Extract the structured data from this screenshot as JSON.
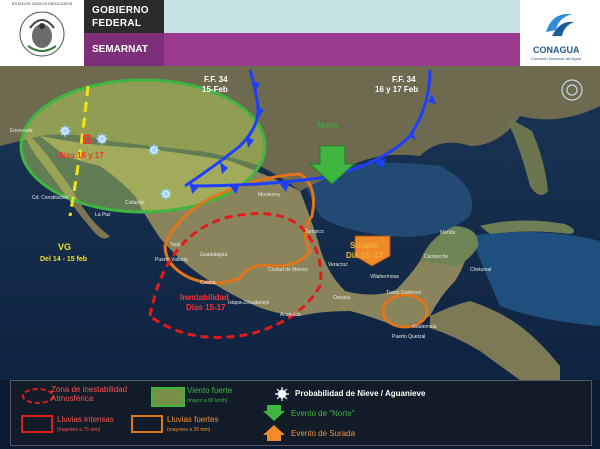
{
  "header": {
    "gov_line1": "GOBIERNO",
    "gov_line2": "FEDERAL",
    "agency": "SEMARNAT",
    "seal_caption": "ESTADOS UNIDOS MEXICANOS",
    "brand": "CONAGUA",
    "brand_sub": "Comisión Nacional del Agua"
  },
  "colors": {
    "wind": "#3fb63f",
    "cold_front": "#1f3fff",
    "instability": "#e01b1b",
    "heavy_rain": "#e0751b",
    "surge": "#f08a2a"
  },
  "map": {
    "fronts": [
      {
        "name": "F.F. 34",
        "date": "15-Feb"
      },
      {
        "name": "F.F. 34",
        "date": "16 y 17 Feb"
      }
    ],
    "low_pressure": {
      "letter": "B",
      "days": "Días 16 y 17"
    },
    "tropical_wave": {
      "code": "VG",
      "dates": "Del 14 - 15 feb"
    },
    "norte_label": "Norte",
    "surge_label_1": "Surada",
    "surge_label_2": "Día 15 -17",
    "instability_label_1": "Inestabilidad",
    "instability_label_2": "Días 15-17",
    "places": [
      "Ensenada",
      "Culiacán",
      "Cd. Constitución",
      "La Paz",
      "Tampico",
      "Colima",
      "Oaxaca",
      "Acapulco",
      "Ixtapa-Zihuatanejo",
      "Tepic",
      "Puerto Vallarta",
      "Veracruz",
      "Campeche",
      "Mérida",
      "Tuxtla Gutiérrez",
      "Guatemala",
      "Guadalajara",
      "Ciudad de México",
      "Villahermosa",
      "Chetumal",
      "Monterrey",
      "Puerto Quetzal"
    ]
  },
  "legend": {
    "instability_title": "Zona de inestabilidad Atmosférica",
    "wind_title": "Viento fuerte",
    "wind_sub": "(mayor a 60 km/h)",
    "snow_title": "Probabilidad de Nieve / Aguanieve",
    "intense_rain_title": "Lluvias intensas",
    "intense_rain_sub": "(mayores a 75 mm)",
    "strong_rain_title": "Lluvias fuertes",
    "strong_rain_sub": "(mayores a 20 mm)",
    "norte_event": "Evento de \"Norte\"",
    "surge_event": "Evento de Surada"
  }
}
